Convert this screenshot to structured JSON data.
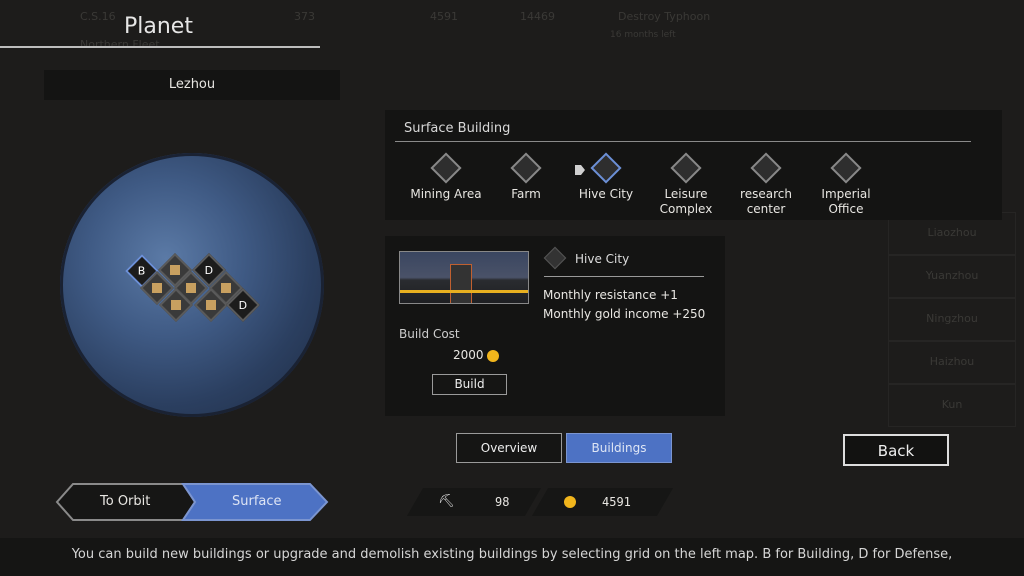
{
  "background_hud": {
    "fleet_id": "C.S.16",
    "fleet_name": "Northern Fleet",
    "hearts": "373",
    "gold": "4591",
    "crystals": "14469",
    "mission": "Destroy Typhoon",
    "mission_sub": "16 months left",
    "planet_list": [
      "Liaozhou",
      "Yuanzhou",
      "Ningzhou",
      "Haizhou",
      "Kun"
    ]
  },
  "header": {
    "title": "Planet"
  },
  "planet": {
    "name": "Lezhou",
    "grid": [
      {
        "type": "B",
        "selected": true
      },
      {
        "type": "building",
        "icon": "imperial-office"
      },
      {
        "type": "D"
      },
      {
        "type": "building",
        "icon": "farm"
      },
      {
        "type": "building",
        "icon": "research-center"
      },
      {
        "type": "building",
        "icon": "mining-area"
      },
      {
        "type": "building",
        "icon": "hive-city"
      },
      {
        "type": "building",
        "icon": "leisure-complex"
      },
      {
        "type": "D"
      }
    ]
  },
  "surface_building": {
    "title": "Surface Building",
    "items": [
      {
        "label": "Mining Area",
        "icon": "mining-area"
      },
      {
        "label": "Farm",
        "icon": "farm"
      },
      {
        "label": "Hive City",
        "icon": "hive-city",
        "selected": true
      },
      {
        "label": "Leisure Complex",
        "icon": "leisure-complex"
      },
      {
        "label": "research center",
        "icon": "research-center"
      },
      {
        "label": "Imperial Office",
        "icon": "imperial-office"
      }
    ]
  },
  "detail": {
    "name": "Hive City",
    "effects": [
      "Monthly resistance  +1",
      "Monthly gold income +250"
    ],
    "cost_label": "Build Cost",
    "cost": "2000",
    "build_label": "Build"
  },
  "tabs": {
    "overview": "Overview",
    "buildings": "Buildings",
    "active": "Buildings"
  },
  "nav": {
    "orbit": "To Orbit",
    "surface": "Surface",
    "active": "Surface"
  },
  "resources": {
    "production": "98",
    "gold": "4591"
  },
  "back_label": "Back",
  "footer": "You can build new buildings or upgrade and demolish existing buildings by selecting grid on the left map. B for Building, D for Defense,",
  "colors": {
    "accent": "#4d72c4",
    "gold": "#f1b51c"
  }
}
